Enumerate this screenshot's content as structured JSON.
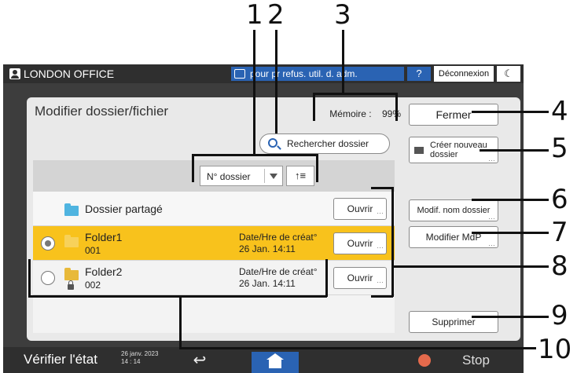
{
  "topbar": {
    "office_name": "LONDON OFFICE",
    "notice_text": "pour pr refus. util. d. adm.",
    "help_label": "?",
    "logout_label": "Déconnexion",
    "mode_label": "☾"
  },
  "panel": {
    "title": "Modifier dossier/fichier",
    "memory_label": "Mémoire :",
    "memory_value": "99%",
    "search_label": "Rechercher dossier",
    "sort": {
      "selected": "N° dossier",
      "order_label": "↑≡"
    },
    "shared_folder": {
      "name": "Dossier partagé",
      "open_label": "Ouvrir"
    },
    "folders": [
      {
        "name": "Folder1",
        "number": "001",
        "date_label": "Date/Hre de créat°",
        "date_value": "26 Jan.   14:11",
        "open_label": "Ouvrir",
        "selected": true,
        "locked": false
      },
      {
        "name": "Folder2",
        "number": "002",
        "date_label": "Date/Hre de créat°",
        "date_value": "26 Jan.   14:11",
        "open_label": "Ouvrir",
        "selected": false,
        "locked": true
      }
    ],
    "side_buttons": {
      "close": "Fermer",
      "new_folder": "Créer nouveau dossier",
      "rename": "Modif. nom dossier",
      "change_password": "Modifier MdP",
      "delete": "Supprimer"
    }
  },
  "bottombar": {
    "status_label": "Vérifier l'état",
    "date": "26 janv. 2023",
    "time": "14 : 14",
    "back_label": "↩",
    "stop_label": "Stop"
  },
  "callouts": [
    "1",
    "2",
    "3",
    "4",
    "5",
    "6",
    "7",
    "8",
    "9",
    "10"
  ],
  "colors": {
    "selected_row": "#f8c21c",
    "accent_blue": "#2a63b3",
    "folder_icon": "#4fb4e0",
    "folder_selected_icon": "#f7d15a",
    "folder_icon_normal": "#e8b93a",
    "stop_icon": "#e56a4c"
  }
}
